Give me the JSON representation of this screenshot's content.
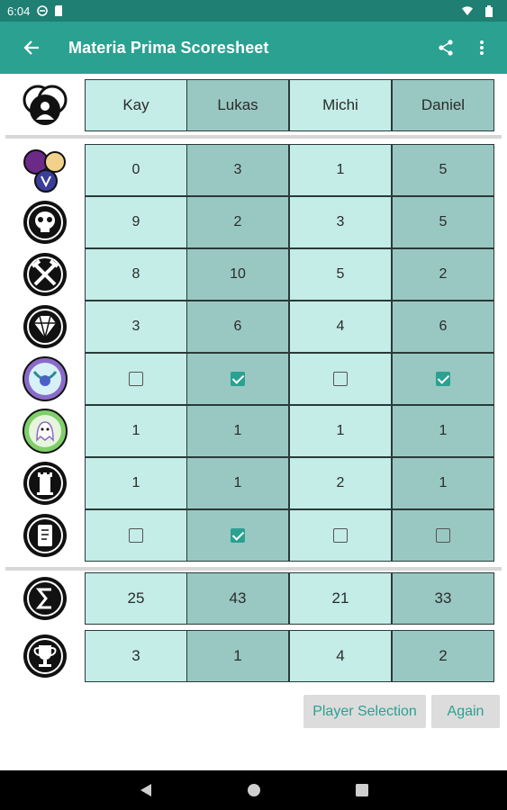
{
  "status_bar": {
    "time": "6:04"
  },
  "app_bar": {
    "title": "Materia Prima Scoresheet"
  },
  "players": [
    "Kay",
    "Lukas",
    "Michi",
    "Daniel"
  ],
  "rows": [
    {
      "icon": "magic-orbs-icon",
      "type": "number",
      "values": [
        "0",
        "3",
        "1",
        "5"
      ]
    },
    {
      "icon": "skull-icon",
      "type": "number",
      "values": [
        "9",
        "2",
        "3",
        "5"
      ]
    },
    {
      "icon": "crossed-tools-icon",
      "type": "number",
      "values": [
        "8",
        "10",
        "5",
        "2"
      ]
    },
    {
      "icon": "gem-icon",
      "type": "number",
      "values": [
        "3",
        "6",
        "4",
        "6"
      ]
    },
    {
      "icon": "purple-gem-icon",
      "type": "check",
      "values": [
        false,
        true,
        false,
        true
      ]
    },
    {
      "icon": "ghost-icon",
      "type": "number",
      "values": [
        "1",
        "1",
        "1",
        "1"
      ]
    },
    {
      "icon": "tower-icon",
      "type": "number",
      "values": [
        "1",
        "1",
        "2",
        "1"
      ]
    },
    {
      "icon": "scroll-icon",
      "type": "check",
      "values": [
        false,
        true,
        false,
        false
      ]
    }
  ],
  "sum_row": {
    "icon": "sum-icon",
    "values": [
      "25",
      "43",
      "21",
      "33"
    ]
  },
  "rank_row": {
    "icon": "trophy-icon",
    "values": [
      "3",
      "1",
      "4",
      "2"
    ]
  },
  "buttons": {
    "player_selection": "Player Selection",
    "again": "Again"
  },
  "colors": {
    "app_bar": "#2aa191",
    "status_bar": "#1f7f73",
    "cell_light": "#c3ede6",
    "cell_dark": "#99c8c2"
  }
}
